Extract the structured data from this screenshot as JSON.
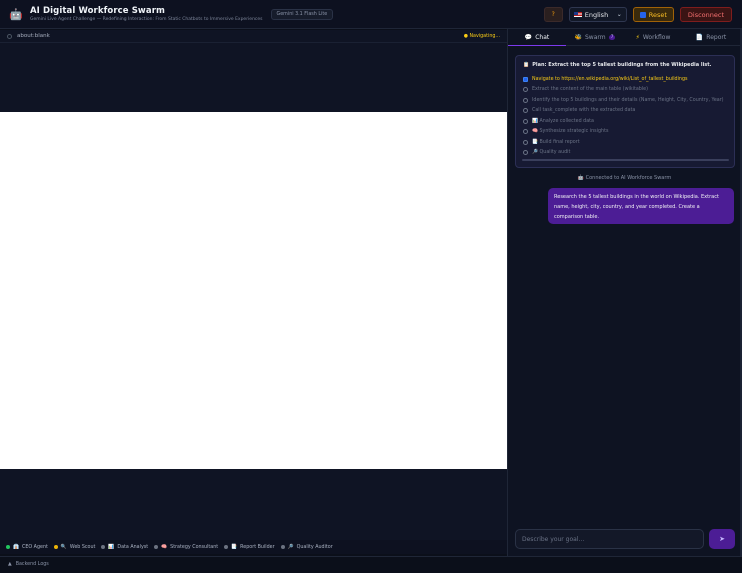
{
  "header": {
    "logo_icon": "robot-logo",
    "title": "AI Digital Workforce Swarm",
    "subtitle": "Gemini Live Agent Challenge — Redefining Interaction: From Static Chatbots to Immersive Experiences",
    "model_badge": "Gemini 3.1 Flash Lite",
    "help_label": "?",
    "language": "English",
    "reset_label": "Reset",
    "disconnect_label": "Disconnect"
  },
  "browser": {
    "url": "about:blank",
    "status": "Navigating..."
  },
  "tabs": [
    {
      "icon": "💬",
      "label": "Chat",
      "active": true
    },
    {
      "icon": "🐝",
      "label": "Swarm",
      "badge": "7"
    },
    {
      "icon": "⚡",
      "label": "Workflow"
    },
    {
      "icon": "📄",
      "label": "Report"
    }
  ],
  "plan": {
    "icon": "📋",
    "title": "Plan: Extract the top 5 tallest buildings from the Wikipedia list.",
    "steps": [
      {
        "text": "Navigate to https://en.wikipedia.org/wiki/List_of_tallest_buildings",
        "state": "active"
      },
      {
        "text": "Extract the content of the main table (wikitable)",
        "state": "pending"
      },
      {
        "text": "Identify the top 5 buildings and their details (Name, Height, City, Country, Year)",
        "state": "pending"
      },
      {
        "text": "Call task_complete with the extracted data",
        "state": "pending"
      },
      {
        "text": "📊 Analyze collected data",
        "state": "pending"
      },
      {
        "text": "🧠 Synthesize strategic insights",
        "state": "pending"
      },
      {
        "text": "📑 Build final report",
        "state": "pending"
      },
      {
        "text": "🔎 Quality audit",
        "state": "pending"
      }
    ]
  },
  "connected_text": "Connected to AI Workforce Swarm",
  "user_message": "Research the 5 tallest buildings in the world on Wikipedia. Extract name, height, city, country, and year completed. Create a comparison table.",
  "input": {
    "placeholder": "Describe your goal...",
    "send_icon": "send-icon"
  },
  "agents": [
    {
      "label": "CEO Agent",
      "icon": "👔",
      "dot": "#22c55e"
    },
    {
      "label": "Web Scout",
      "icon": "🔍",
      "dot": "#eab308"
    },
    {
      "label": "Data Analyst",
      "icon": "📊",
      "dot": "#6b7280"
    },
    {
      "label": "Strategy Consultant",
      "icon": "🧠",
      "dot": "#6b7280"
    },
    {
      "label": "Report Builder",
      "icon": "📑",
      "dot": "#6b7280"
    },
    {
      "label": "Quality Auditor",
      "icon": "🔎",
      "dot": "#6b7280"
    }
  ],
  "logs_label": "Backend Logs",
  "colors": {
    "accent": "#7c3aed",
    "bg": "#0b0f1a",
    "warning": "#facc15",
    "danger": "#f87171"
  }
}
